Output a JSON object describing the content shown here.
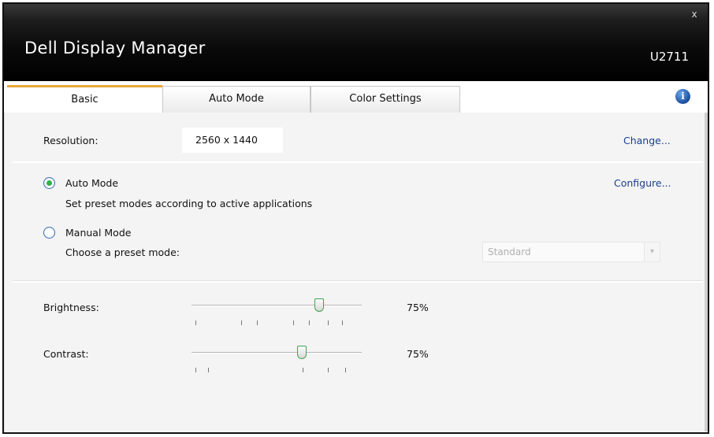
{
  "app": {
    "title": "Dell Display Manager",
    "close_label": "x",
    "header_right": "U2711"
  },
  "tabs": [
    {
      "label": "Basic",
      "active": true
    },
    {
      "label": "Auto Mode",
      "active": false
    },
    {
      "label": "Color Settings",
      "active": false
    }
  ],
  "info_icon": {
    "glyph": "i",
    "icon": "info-icon"
  },
  "basic": {
    "resolution_label": "Resolution:",
    "resolution_value": "2560 x 1440",
    "change_link": "Change...",
    "auto_mode": {
      "label": "Auto Mode",
      "selected": true,
      "description": "Set preset modes according to active applications",
      "configure_link": "Configure..."
    },
    "manual_mode": {
      "label": "Manual Mode",
      "selected": false,
      "description": "Choose a preset mode:",
      "select_value": "Standard"
    },
    "brightness": {
      "label": "Brightness:",
      "value_text": "75%",
      "value": 75
    },
    "contrast": {
      "label": "Contrast:",
      "value_text": "75%",
      "value": 65
    }
  },
  "colors": {
    "accent_tab": "#e8a838",
    "link": "#1a3e8c",
    "radio_selected": "#35b04a"
  }
}
